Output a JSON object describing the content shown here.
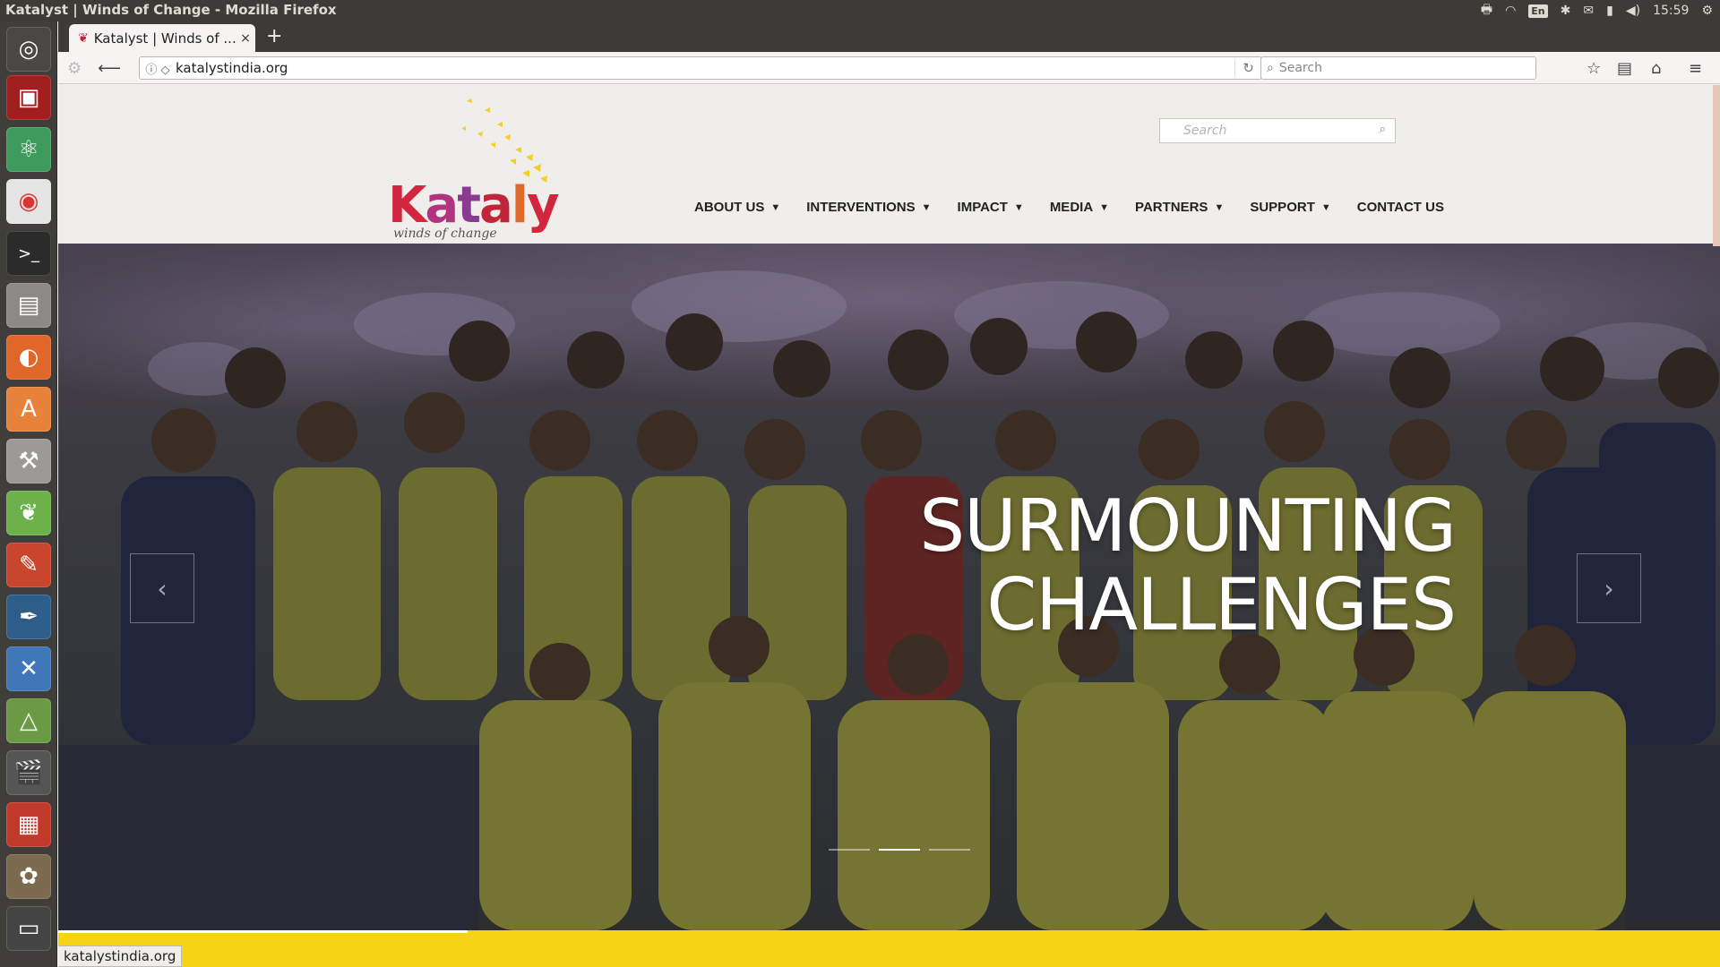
{
  "window": {
    "title": "Katalyst | Winds of Change - Mozilla Firefox"
  },
  "top_panel": {
    "indicators": [
      "printer-icon",
      "wifi-icon",
      "keyboard-layout",
      "bluetooth-icon",
      "mail-icon",
      "battery-icon",
      "volume-icon"
    ],
    "language": "En",
    "clock": "15:59"
  },
  "launcher": {
    "items": [
      "ubuntu-dash",
      "screen-recorder",
      "atom-editor",
      "chrome",
      "terminal",
      "files",
      "firefox",
      "software-center",
      "system-settings",
      "leaf-app",
      "pencil-app",
      "inkscape",
      "xfig",
      "geogebra",
      "video-editor",
      "document-viewer",
      "gimp",
      "usb-drive"
    ]
  },
  "browser": {
    "tab_title": "Katalyst | Winds of ...",
    "tab_close": "×",
    "new_tab": "+",
    "url": "katalystindia.org",
    "search_placeholder": "Search"
  },
  "site": {
    "logo": {
      "wordmark": "Katalyst",
      "tagline": "winds of change"
    },
    "search_placeholder": "Search",
    "menu": [
      {
        "label": "ABOUT US",
        "has_dropdown": true
      },
      {
        "label": "INTERVENTIONS",
        "has_dropdown": true
      },
      {
        "label": "IMPACT",
        "has_dropdown": true
      },
      {
        "label": "MEDIA",
        "has_dropdown": true
      },
      {
        "label": "PARTNERS",
        "has_dropdown": true
      },
      {
        "label": "SUPPORT",
        "has_dropdown": true
      },
      {
        "label": "CONTACT US",
        "has_dropdown": false
      }
    ],
    "hero": {
      "headline_line1": "SURMOUNTING",
      "headline_line2": "CHALLENGES",
      "slides": 3,
      "active_slide": 2
    }
  },
  "statusbar": {
    "text": "katalystindia.org"
  },
  "colors": {
    "accent_yellow": "#f6d314",
    "brand_red": "#c0263a",
    "brand_magenta": "#b0347e"
  }
}
